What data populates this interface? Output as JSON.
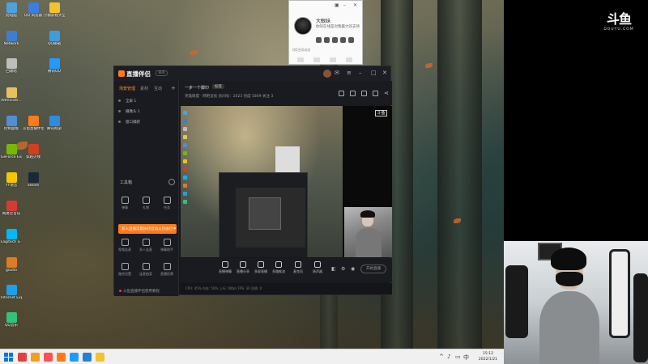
{
  "desktop": {
    "icons": [
      {
        "label": "此电脑",
        "color": "#4aa3df"
      },
      {
        "label": "QQ 浏览器",
        "color": "#3b7de0"
      },
      {
        "label": "小鹅影视大全",
        "color": "#f2c230"
      },
      {
        "label": "Network",
        "color": "#3c7fd0"
      },
      {
        "label": "QQ邮箱",
        "color": "#3c9ee0"
      },
      {
        "label": "回收站",
        "color": "#bdbdbd"
      },
      {
        "label": "腾讯QQ",
        "color": "#1f9bff"
      },
      {
        "label": "Administr...",
        "color": "#e6c35a"
      },
      {
        "label": "控制面板",
        "color": "#4f8fd4"
      },
      {
        "label": "斗鱼直播伴侣",
        "color": "#ff7a1a"
      },
      {
        "label": "腾讯网游",
        "color": "#2e8be0"
      },
      {
        "label": "GeForce Experience",
        "color": "#76b900"
      },
      {
        "label": "穿越火线",
        "color": "#d04020"
      },
      {
        "label": "YY语音",
        "color": "#f4c500"
      },
      {
        "label": "Steam",
        "color": "#1b2838"
      },
      {
        "label": "网易云音乐",
        "color": "#d43c33"
      },
      {
        "label": "Logitech G HUB",
        "color": "#00b8fc"
      },
      {
        "label": "gouflo",
        "color": "#e07b20"
      },
      {
        "label": "Internet Explorer",
        "color": "#1ea0e8"
      },
      {
        "label": "QQ音乐",
        "color": "#31c27c"
      }
    ]
  },
  "qq_popup": {
    "name": "大眼妹",
    "subtitle": "你的在线是对我最大的支持",
    "footer": "QQ空间动态"
  },
  "app": {
    "name": "直播伴侣",
    "version": "8.0",
    "tabs": [
      "场景管理",
      "素材",
      "互动"
    ],
    "scenes": [
      "全屏 1",
      "摄像头 1",
      "窗口捕获"
    ],
    "tools_title": "工具箱",
    "tools": [
      "弹幕",
      "礼物",
      "任务",
      "视频连麦",
      "多人连麦",
      "弹幕助手",
      "路径设置",
      "连麦抽奖",
      "直播投票"
    ],
    "promo": "新人直播流量扶持活动火热进行中，参与即得 →",
    "footer": "斗鱼直播伴侣使用教程",
    "room": {
      "title": "一步一个脚印",
      "tag": "标签",
      "meta": "英雄联盟 · 网吧竞技    房间号：2023    热度 5809    关注 3"
    },
    "preview_logo": "斗鱼",
    "toolbar": [
      "直播弹幕",
      "直播分享",
      "多屏直播",
      "多路推流",
      "麦克风",
      "扬声器"
    ],
    "start_live": "开始直播",
    "status": "CPU: 45%   内存: 56%   上行: 0Kb/s   FPS: 30   丢帧: 0"
  },
  "stream": {
    "logo": "斗鱼",
    "logo_sub": "DOUYU.COM"
  },
  "taskbar": {
    "time": "15:12",
    "date": "2022/1/21",
    "apps": [
      {
        "color": "#e04040"
      },
      {
        "color": "#f0a020"
      },
      {
        "color": "#ff5050"
      },
      {
        "color": "#ff7a1a"
      },
      {
        "color": "#1f9bff"
      },
      {
        "color": "#2a7fd0"
      },
      {
        "color": "#f2c230"
      }
    ]
  }
}
